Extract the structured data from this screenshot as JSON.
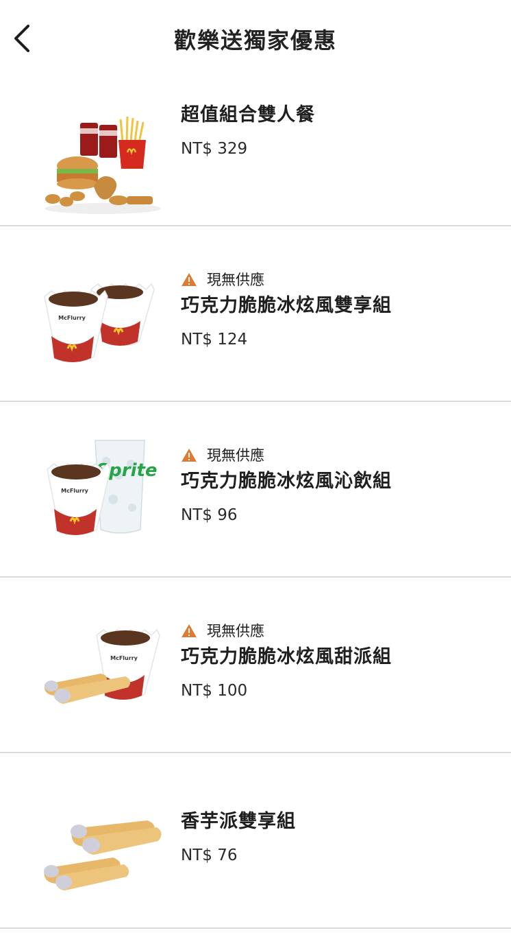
{
  "header": {
    "title": "歡樂送獨家優惠",
    "back_icon": "chevron-left-icon"
  },
  "items": [
    {
      "name": "超值組合雙人餐",
      "price": "NT$ 329",
      "notice": ""
    },
    {
      "name": "巧克力脆脆冰炫風雙享組",
      "price": "NT$ 124",
      "notice": "現無供應"
    },
    {
      "name": "巧克力脆脆冰炫風沁飲組",
      "price": "NT$ 96",
      "notice": "現無供應"
    },
    {
      "name": "巧克力脆脆冰炫風甜派組",
      "price": "NT$ 100",
      "notice": "現無供應"
    },
    {
      "name": "香芋派雙享組",
      "price": "NT$ 76",
      "notice": ""
    }
  ],
  "product_images": {
    "mcflurry_brand": "McFlurry",
    "mcflurry_flavor": "巧克力脆脆冰炫風",
    "sprite_brand": "Sprite"
  },
  "colors": {
    "warning": "#e07a2e",
    "divider": "#d9d9d9",
    "mcd_red": "#d52b1e",
    "mcd_yellow": "#ffc72c"
  }
}
